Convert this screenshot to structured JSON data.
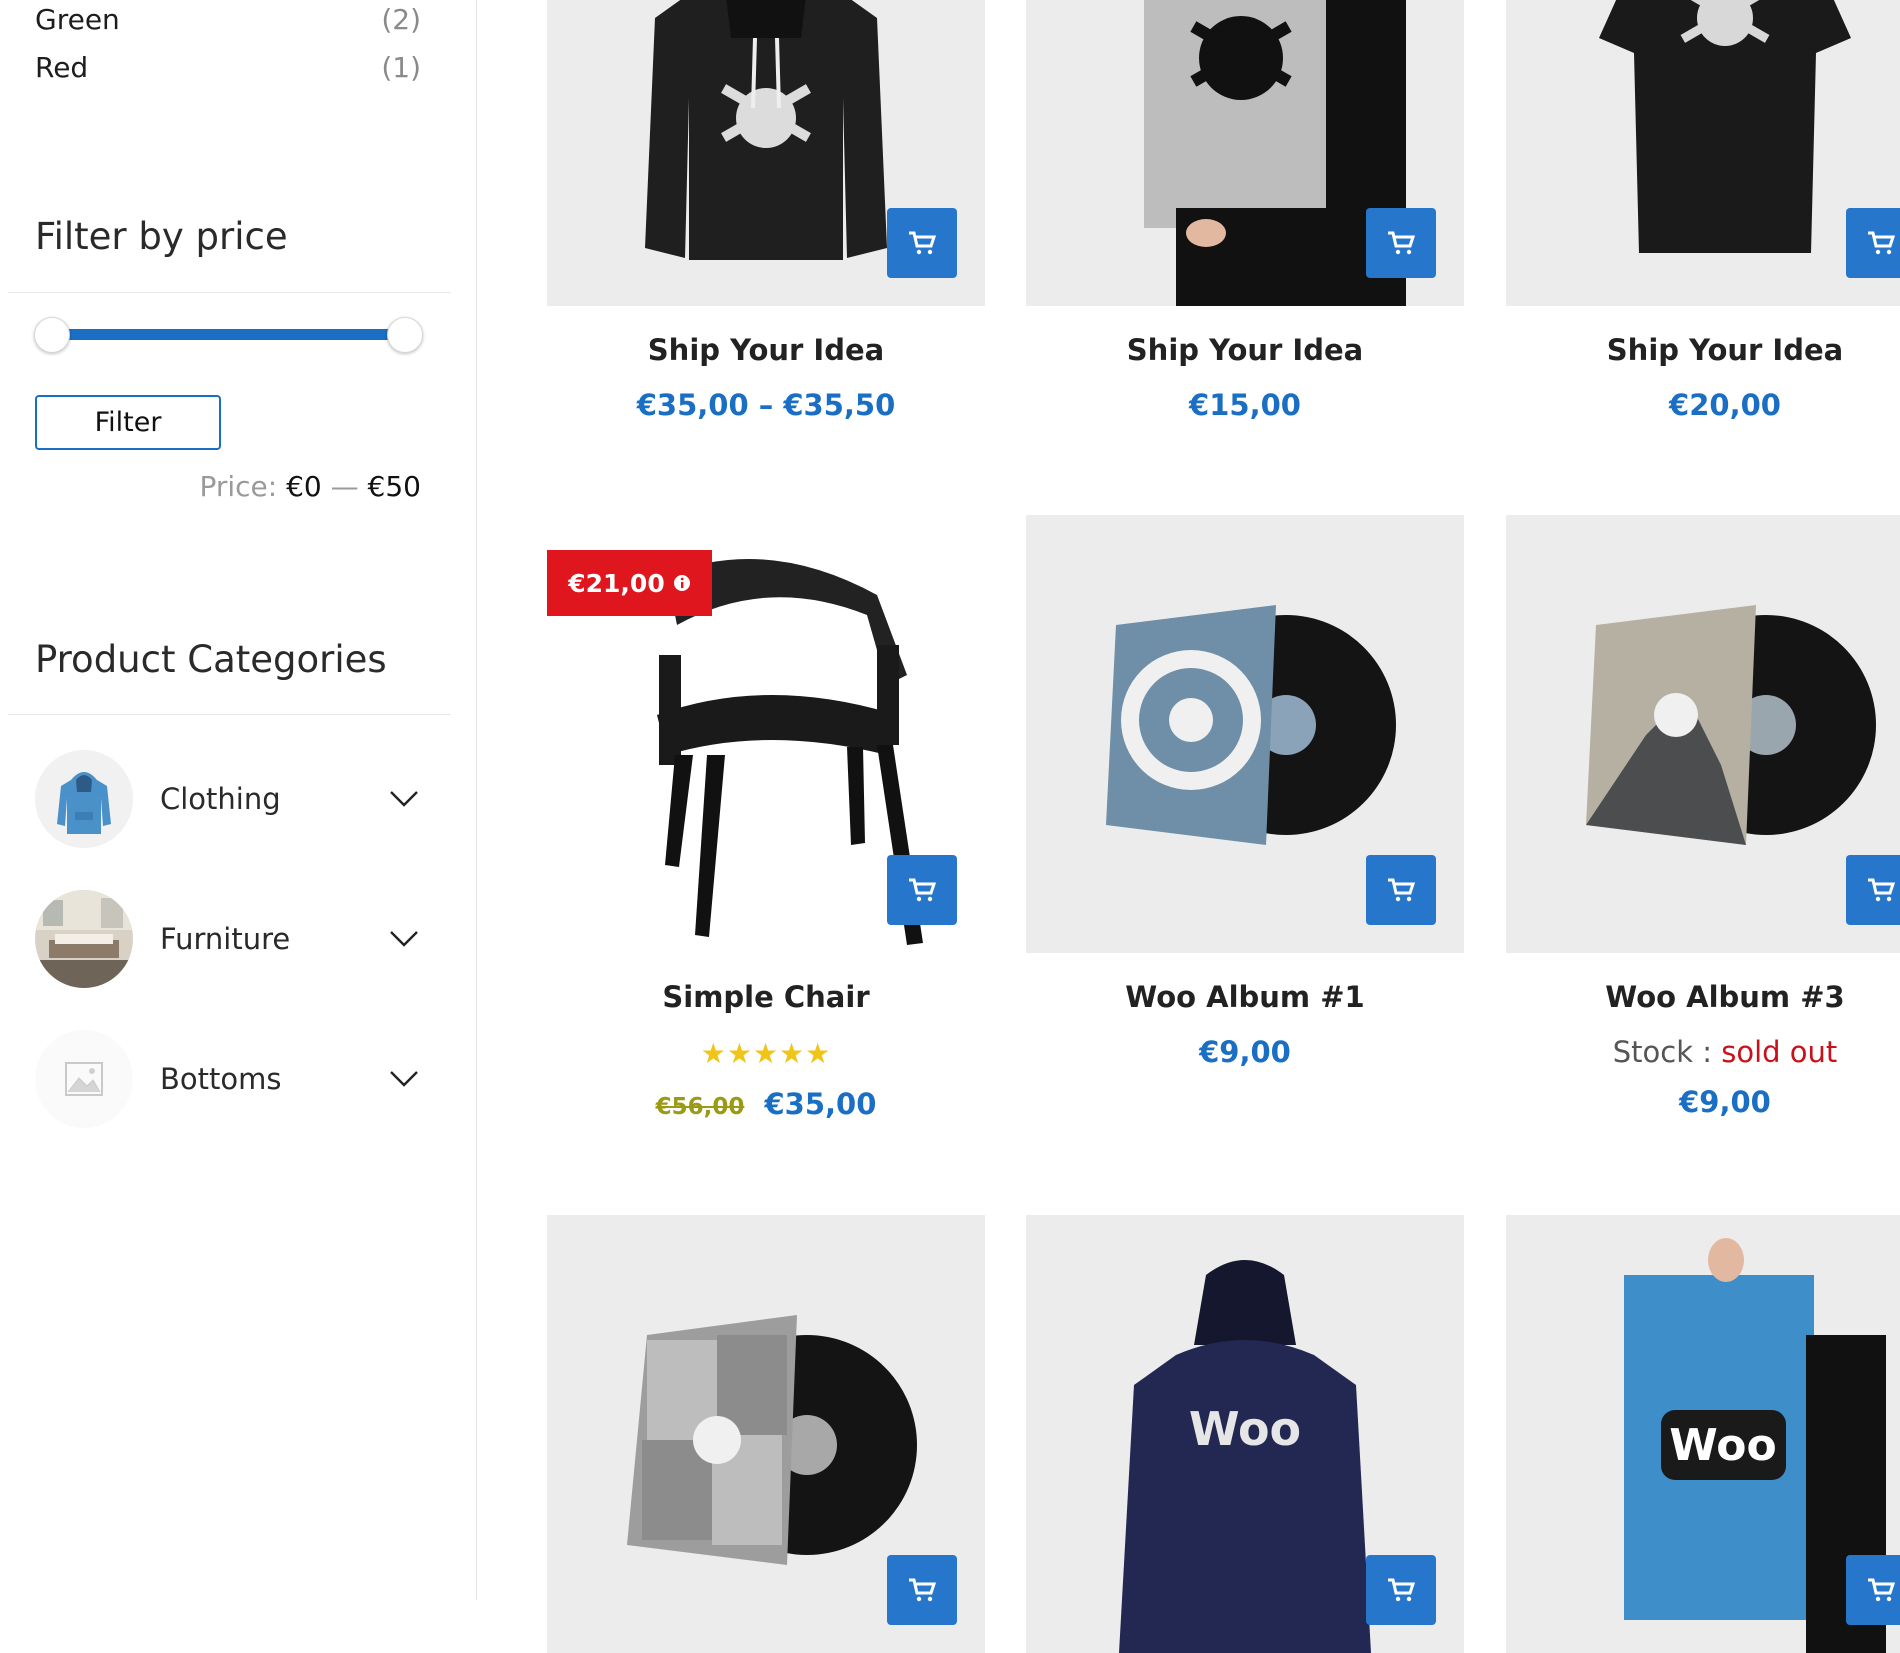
{
  "sidebar": {
    "colors": [
      {
        "name": "Green",
        "count": "(2)"
      },
      {
        "name": "Red",
        "count": "(1)"
      }
    ],
    "price_filter": {
      "title": "Filter by price",
      "button_label": "Filter",
      "price_label": "Price:",
      "min": "€0",
      "separator": "—",
      "max": "€50"
    },
    "categories": {
      "title": "Product Categories",
      "items": [
        {
          "label": "Clothing"
        },
        {
          "label": "Furniture"
        },
        {
          "label": "Bottoms"
        }
      ]
    }
  },
  "products": [
    {
      "title": "Ship Your Idea",
      "price": "€35,00 – €35,50"
    },
    {
      "title": "Ship Your Idea",
      "price": "€15,00"
    },
    {
      "title": "Ship Your Idea",
      "price": "€20,00"
    },
    {
      "title": "Simple Chair",
      "sale_badge": "€21,00",
      "rating_stars": "★★★★★",
      "old_price": "€56,00",
      "price": "€35,00"
    },
    {
      "title": "Woo Album #1",
      "price": "€9,00"
    },
    {
      "title": "Woo Album #3",
      "stock_label": "Stock :",
      "stock_status": "sold out",
      "price": "€9,00"
    }
  ],
  "colors": {
    "accent": "#1a6fc4",
    "cart_button": "#2677cc",
    "sale_badge": "#e0161e",
    "sold_out": "#c8111a",
    "star": "#f0c419"
  }
}
